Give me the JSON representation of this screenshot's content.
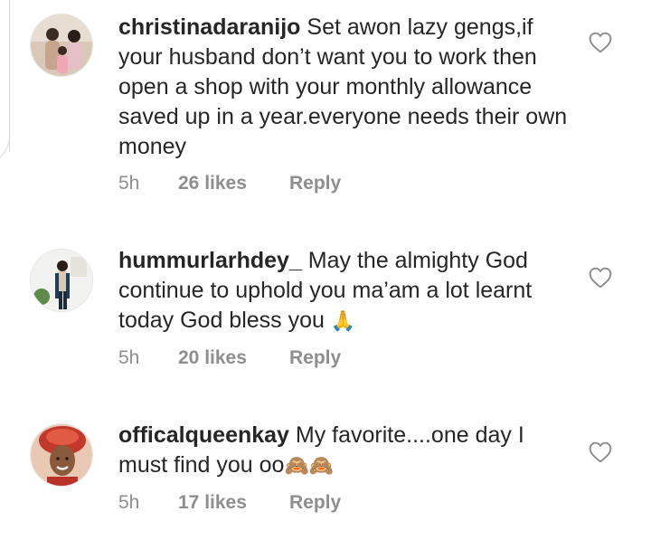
{
  "comments": [
    {
      "username": "christinadaranijo",
      "text": " Set awon lazy gengs,if your husband don’t want you to work then open a shop with your monthly allowance saved up in a year.everyone needs their own money",
      "emoji": "",
      "time": "5h",
      "likes": "26 likes",
      "reply_label": "Reply",
      "avatar_icon": "avatar-family-photo",
      "like_icon": "heart-outline-icon"
    },
    {
      "username": "hummurlarhdey_",
      "text": " May the almighty God continue to uphold you ma’am a lot learnt today God bless you ",
      "emoji": "🙏",
      "time": "5h",
      "likes": "20 likes",
      "reply_label": "Reply",
      "avatar_icon": "avatar-standing-woman",
      "like_icon": "heart-outline-icon"
    },
    {
      "username": "officalqueenkay",
      "text": " My favorite....one day I must find you oo",
      "emoji": "🙈🙈",
      "time": "5h",
      "likes": "17 likes",
      "reply_label": "Reply",
      "avatar_icon": "avatar-woman-headwrap",
      "like_icon": "heart-outline-icon"
    }
  ],
  "colors": {
    "text": "#262626",
    "meta": "#8e8e8e",
    "heart_stroke": "#8e8e8e",
    "background": "#ffffff"
  }
}
